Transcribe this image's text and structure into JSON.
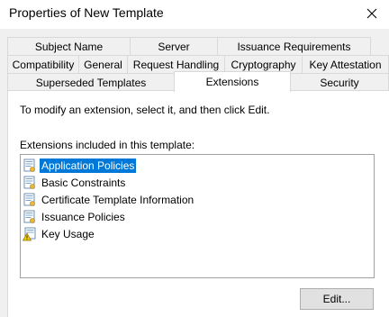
{
  "window": {
    "title": "Properties of New Template",
    "close_icon": "close-icon"
  },
  "tabs": {
    "row1": [
      "Subject Name",
      "Server",
      "Issuance Requirements"
    ],
    "row2": [
      "Compatibility",
      "General",
      "Request Handling",
      "Cryptography",
      "Key Attestation"
    ],
    "row3": [
      "Superseded Templates",
      "Extensions",
      "Security"
    ],
    "active": "Extensions"
  },
  "panel": {
    "instruction": "To modify an extension, select it, and then click Edit.",
    "list_label": "Extensions included in this template:",
    "extensions": [
      {
        "label": "Application Policies",
        "icon": "certificate-extension-icon",
        "selected": true
      },
      {
        "label": "Basic Constraints",
        "icon": "certificate-extension-icon",
        "selected": false
      },
      {
        "label": "Certificate Template Information",
        "icon": "certificate-extension-icon",
        "selected": false
      },
      {
        "label": "Issuance Policies",
        "icon": "certificate-extension-icon",
        "selected": false
      },
      {
        "label": "Key Usage",
        "icon": "warning-extension-icon",
        "selected": false
      }
    ],
    "edit_label": "Edit..."
  },
  "colors": {
    "selection": "#0078d7",
    "dialog_bg": "#f0f0f0"
  }
}
